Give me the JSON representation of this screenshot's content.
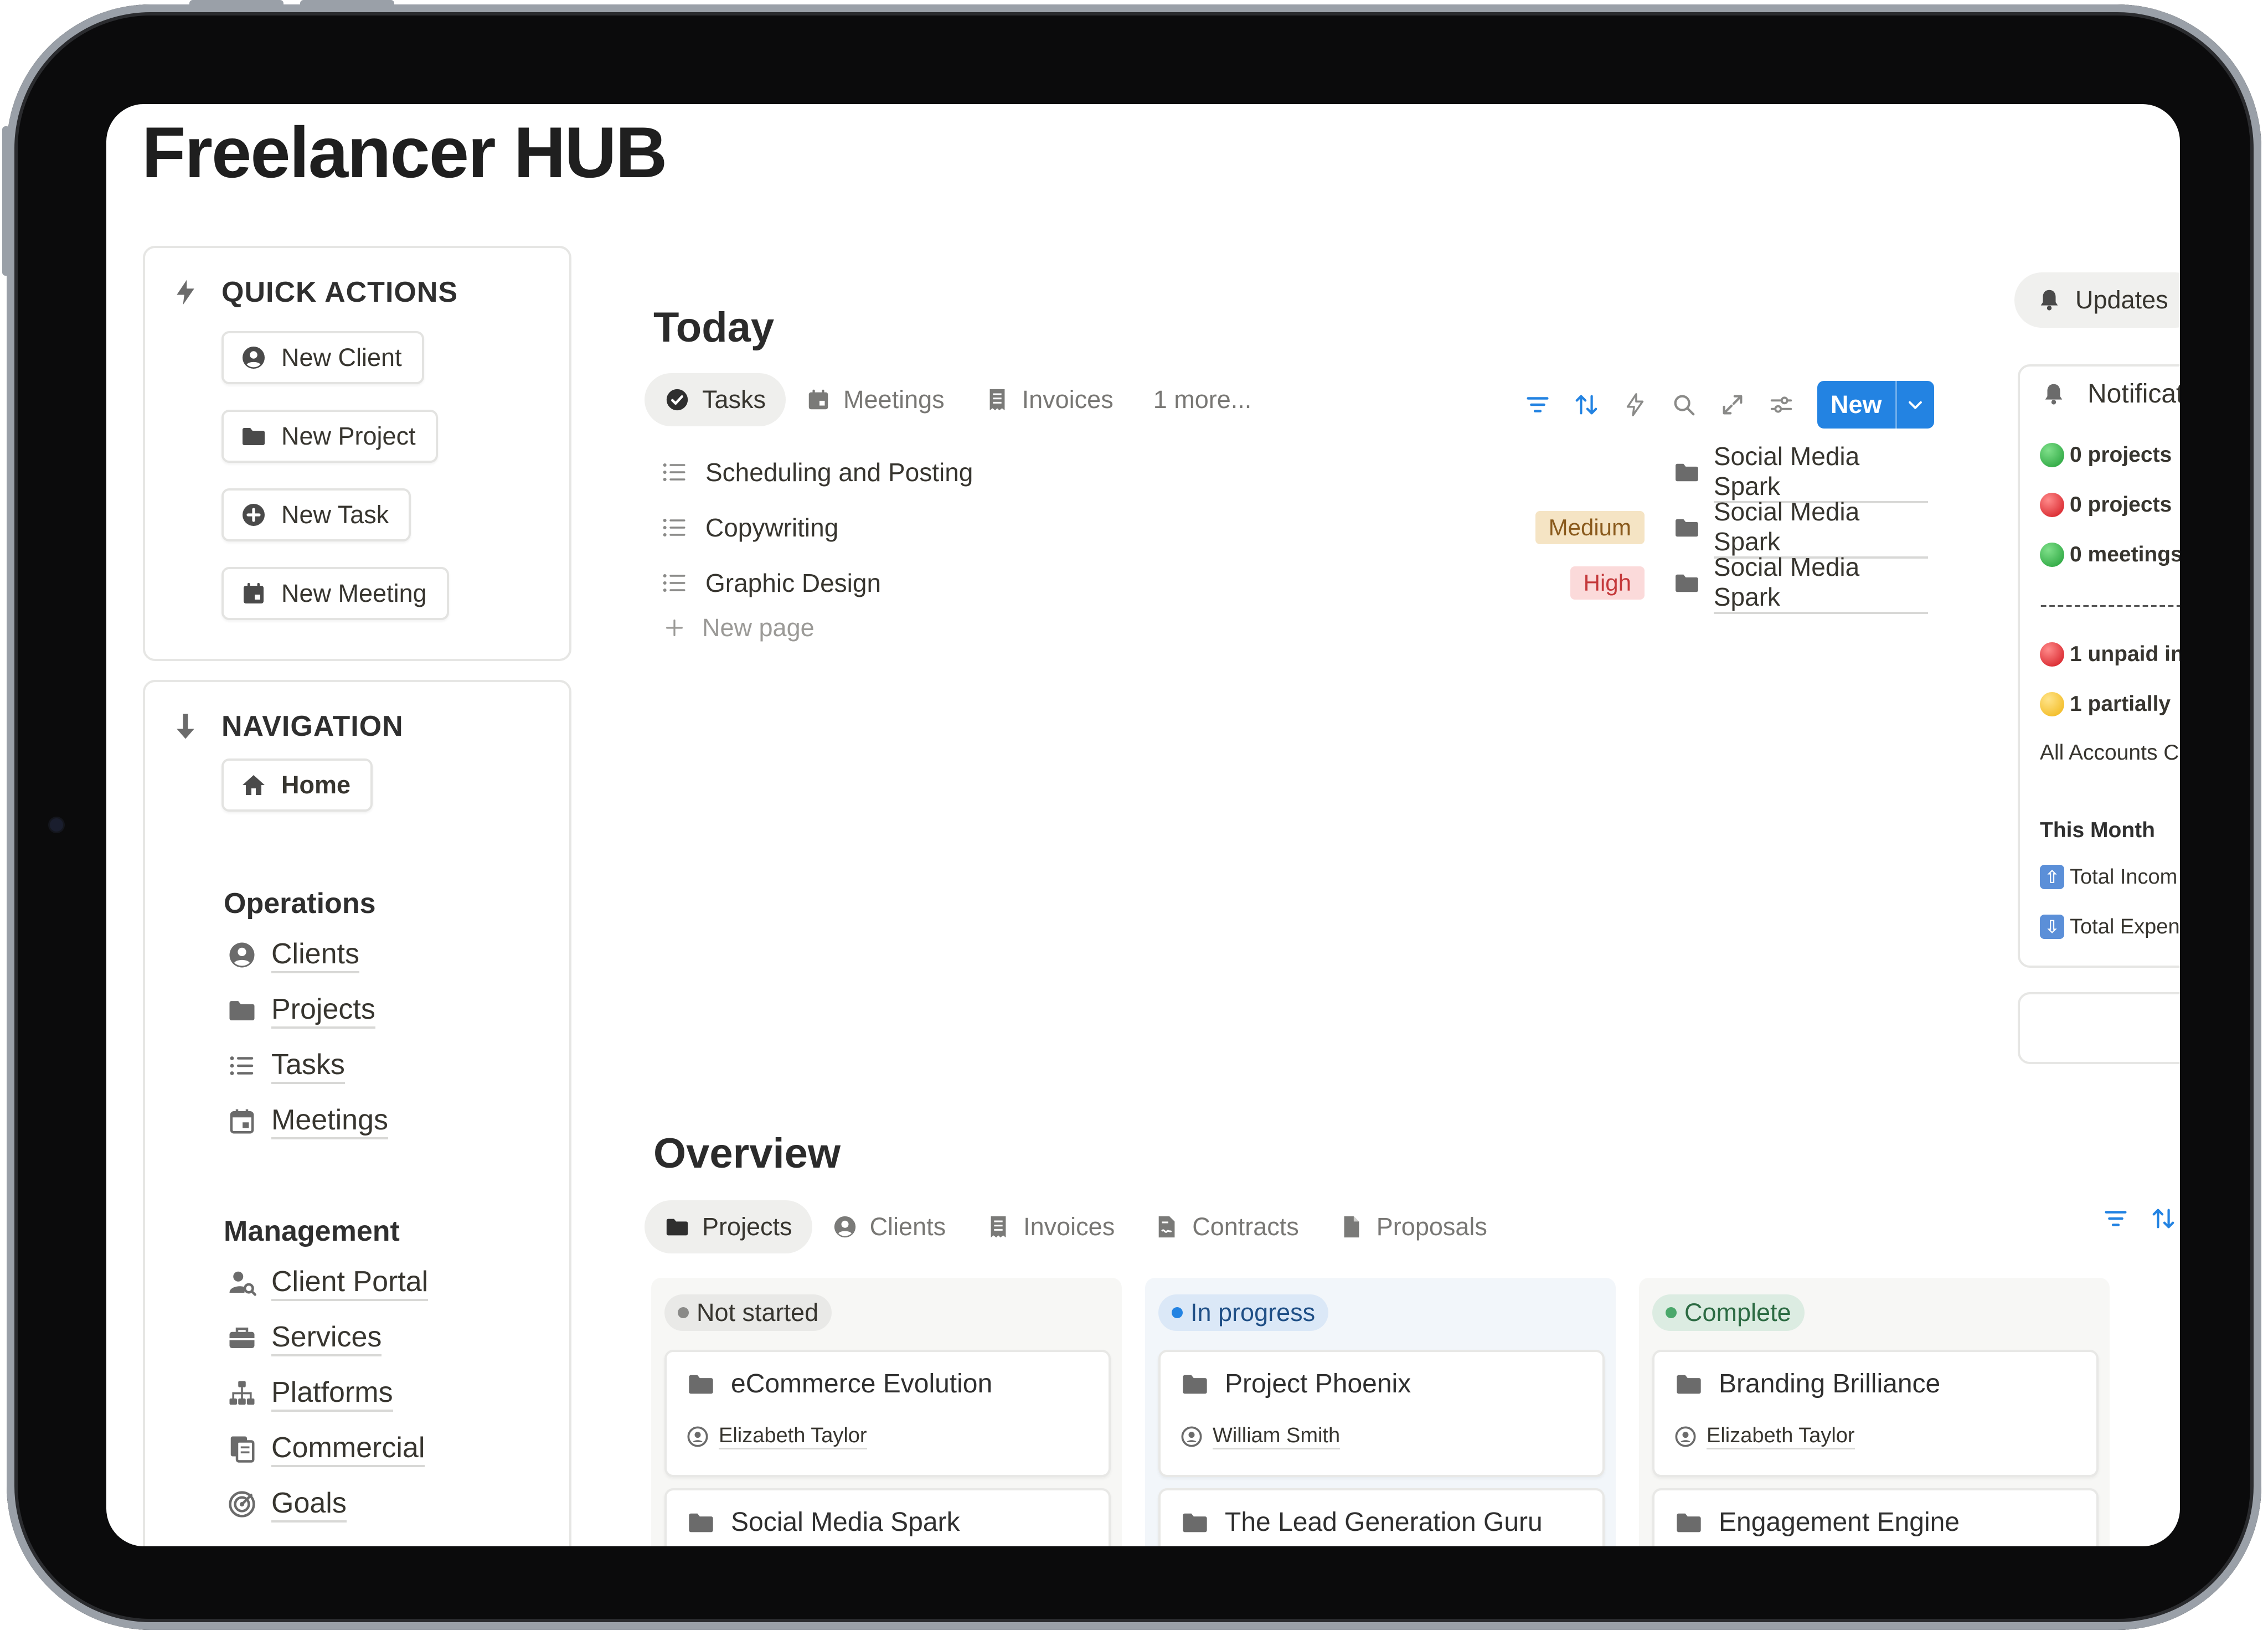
{
  "page": {
    "title": "Freelancer HUB"
  },
  "quick_actions": {
    "title": "QUICK ACTIONS",
    "buttons": [
      {
        "label": "New Client",
        "icon": "user-circle-icon"
      },
      {
        "label": "New Project",
        "icon": "folder-icon"
      },
      {
        "label": "New Task",
        "icon": "plus-circle-icon"
      },
      {
        "label": "New Meeting",
        "icon": "calendar-icon"
      }
    ]
  },
  "navigation": {
    "title": "NAVIGATION",
    "home": "Home",
    "operations": {
      "title": "Operations",
      "items": [
        {
          "label": "Clients"
        },
        {
          "label": "Projects"
        },
        {
          "label": "Tasks"
        },
        {
          "label": "Meetings"
        }
      ]
    },
    "management": {
      "title": "Management",
      "items": [
        {
          "label": "Client Portal"
        },
        {
          "label": "Services"
        },
        {
          "label": "Platforms"
        },
        {
          "label": "Commercial"
        },
        {
          "label": "Goals"
        }
      ]
    }
  },
  "today": {
    "title": "Today",
    "tabs": [
      {
        "label": "Tasks"
      },
      {
        "label": "Meetings"
      },
      {
        "label": "Invoices"
      },
      {
        "label": "1 more..."
      }
    ],
    "new_button": "New",
    "tasks": [
      {
        "name": "Scheduling and Posting",
        "priority": "",
        "project": "Social Media Spark"
      },
      {
        "name": "Copywriting",
        "priority": "Medium",
        "project": "Social Media Spark"
      },
      {
        "name": "Graphic Design",
        "priority": "High",
        "project": "Social Media Spark"
      }
    ],
    "new_page": "New page"
  },
  "overview": {
    "title": "Overview",
    "tabs": [
      {
        "label": "Projects"
      },
      {
        "label": "Clients"
      },
      {
        "label": "Invoices"
      },
      {
        "label": "Contracts"
      },
      {
        "label": "Proposals"
      }
    ],
    "columns": [
      {
        "status": "Not started",
        "cards": [
          {
            "title": "eCommerce Evolution",
            "client": "Elizabeth Taylor"
          },
          {
            "title": "Social Media Spark"
          }
        ]
      },
      {
        "status": "In progress",
        "cards": [
          {
            "title": "Project Phoenix",
            "client": "William Smith"
          },
          {
            "title": "The Lead Generation Guru"
          }
        ]
      },
      {
        "status": "Complete",
        "cards": [
          {
            "title": "Branding Brilliance",
            "client": "Elizabeth Taylor"
          },
          {
            "title": "Engagement Engine"
          }
        ]
      }
    ]
  },
  "updates": {
    "button": "Updates",
    "notifications_title": "Notifications",
    "items": [
      {
        "text": "0 projects",
        "color": "#2fb344"
      },
      {
        "text": "0 projects",
        "color": "#e5262e"
      },
      {
        "text": "0 meetings",
        "color": "#2fb344"
      }
    ],
    "separator": "--------------------",
    "invoices": [
      {
        "text": "1 unpaid in",
        "color": "#e5262e"
      },
      {
        "text": "1 partially",
        "color": "#f5c12e"
      }
    ],
    "all_accounts": "All Accounts C",
    "this_month": "This Month",
    "total_income": "Total Incom",
    "total_expenses": "Total Expen"
  },
  "colors": {
    "accent": "#2383e2",
    "badge_medium_bg": "#f5e4c4",
    "badge_medium_text": "#8a5a1c",
    "badge_high_bg": "#fbdada",
    "badge_high_text": "#c4383a"
  }
}
